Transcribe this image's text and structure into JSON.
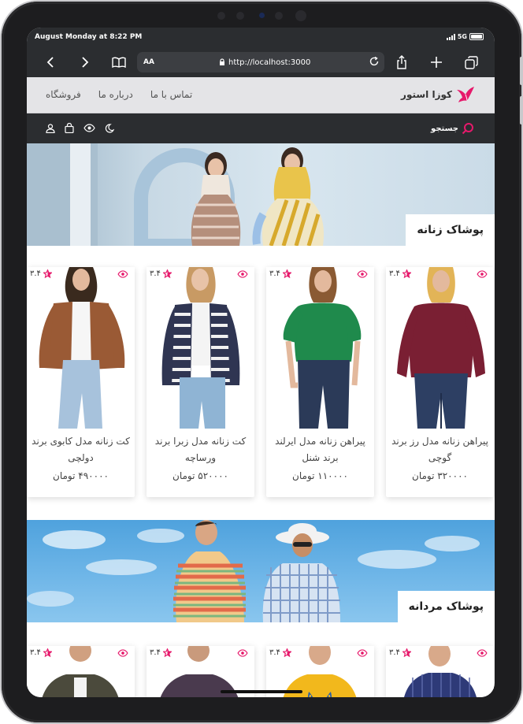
{
  "status": {
    "time": "August Monday at 8:22 PM",
    "network": "5G"
  },
  "browser": {
    "reader_label": "AA",
    "url": "http://localhost:3000"
  },
  "site": {
    "logo_text": "کوزا استور",
    "nav": [
      {
        "label": "فروشگاه"
      },
      {
        "label": "درباره ما"
      },
      {
        "label": "تماس با ما"
      }
    ],
    "search_label": "جستجو"
  },
  "women": {
    "banner_label": "پوشاک زنانه",
    "products": [
      {
        "title": "پیراهن زنانه مدل رز برند گوچی",
        "price": "۳۲۰۰۰۰ تومان",
        "rating": "۳.۴",
        "garment_color": "#7a1f33"
      },
      {
        "title": "پیراهن زنانه مدل ایرلند برند شنل",
        "price": "۱۱۰۰۰۰ تومان",
        "rating": "۳.۴",
        "garment_color": "#1f8a4c"
      },
      {
        "title": "کت زنانه مدل زبرا برند ورساچه",
        "price": "۵۲۰۰۰۰ تومان",
        "rating": "۳.۴",
        "garment_color": "#2f3552"
      },
      {
        "title": "کت زنانه مدل کابوی برند دولچی",
        "price": "۴۹۰۰۰۰ تومان",
        "rating": "۳.۴",
        "garment_color": "#9a5a35"
      }
    ]
  },
  "men": {
    "banner_label": "پوشاک مردانه",
    "products": [
      {
        "rating": "۳.۴",
        "garment_color": "#2e3a78"
      },
      {
        "rating": "۳.۴",
        "garment_color": "#f2b81c"
      },
      {
        "rating": "۳.۴",
        "garment_color": "#4a3a4e"
      },
      {
        "rating": "۳.۴",
        "garment_color": "#4b4a3c"
      }
    ]
  },
  "colors": {
    "accent": "#e6196b",
    "chrome": "#2b2d30",
    "nav_bg": "#e4e4e7"
  }
}
